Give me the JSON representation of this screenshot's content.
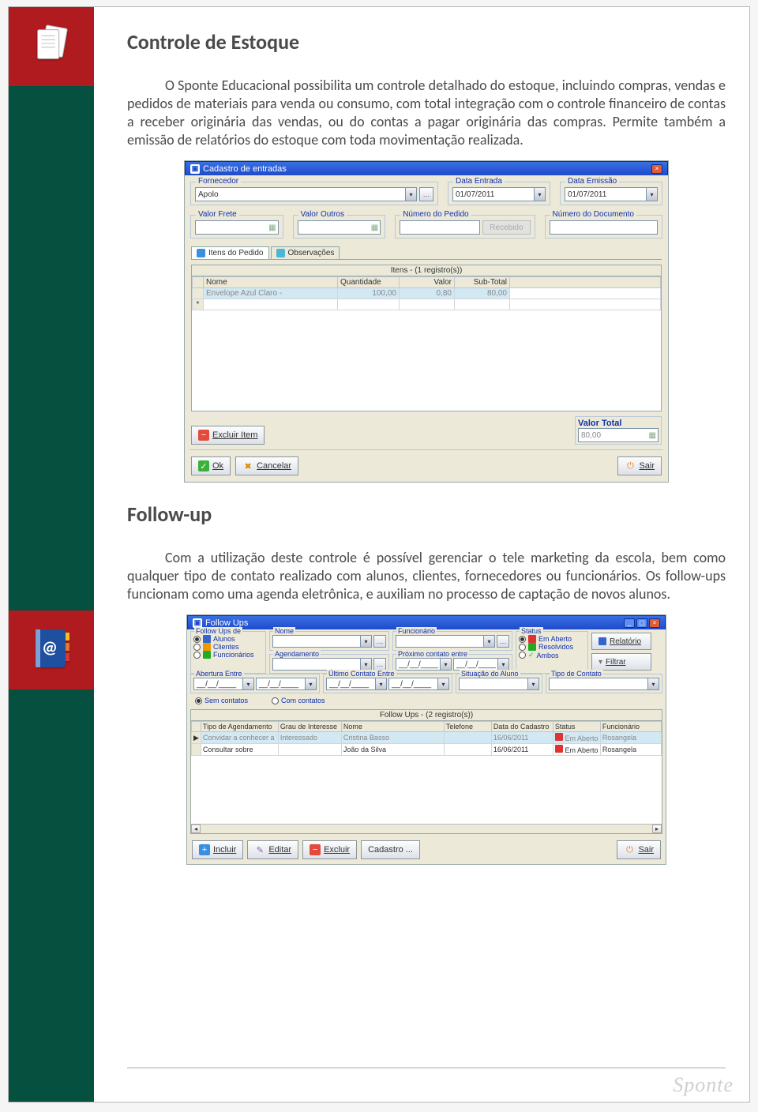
{
  "section1": {
    "heading": "Controle de Estoque",
    "paragraph": "O Sponte Educacional possibilita um controle detalhado do estoque, incluindo compras, vendas e pedidos de materiais para venda ou consumo, com total integração com o controle financeiro de contas a receber originária das vendas, ou do contas a pagar originária das compras. Permite também a emissão de relatórios do estoque com toda movimentação realizada."
  },
  "win1": {
    "title": "Cadastro de entradas",
    "fornecedor_label": "Fornecedor",
    "fornecedor_value": "Apolo",
    "data_entrada_label": "Data Entrada",
    "data_entrada_value": "01/07/2011",
    "data_emissao_label": "Data Emissão",
    "data_emissao_value": "01/07/2011",
    "valor_frete_label": "Valor Frete",
    "valor_outros_label": "Valor Outros",
    "numero_pedido_label": "Número do Pedido",
    "numero_doc_label": "Número do Documento",
    "disabled_btn": "Recebido",
    "tab_itens": "Itens do Pedido",
    "tab_obs": "Observações",
    "grid_caption": "Itens - (1 registro(s))",
    "cols": {
      "nome": "Nome",
      "qtd": "Quantidade",
      "valor": "Valor",
      "sub": "Sub-Total"
    },
    "row": {
      "nome": "Envelope Azul Claro -",
      "qtd": "100,00",
      "valor": "0,80",
      "sub": "80,00"
    },
    "excluir_item": "Excluir Item",
    "valor_total_label": "Valor Total",
    "valor_total_value": "80,00",
    "ok": "Ok",
    "cancelar": "Cancelar",
    "sair": "Sair"
  },
  "section2": {
    "heading": "Follow-up",
    "paragraph": "Com a utilização deste controle é possível gerenciar o tele marketing da escola, bem como qualquer tipo de contato realizado com alunos, clientes, fornecedores ou funcionários. Os follow-ups funcionam como uma agenda eletrônica, e auxiliam no processo de captação de novos alunos."
  },
  "win2": {
    "title": "Follow Ups",
    "followups_de": "Follow Ups de",
    "opt_alunos": "Alunos",
    "opt_clientes": "Clientes",
    "opt_func": "Funcionários",
    "nome_label": "Nome",
    "agendamento_label": "Agendamento",
    "date_mask": "__/__/____",
    "funcionario_label": "Funcionário",
    "proximo_label": "Próximo contato entre",
    "status_label": "Status",
    "status_aberto": "Em Aberto",
    "status_resolv": "Resolvidos",
    "status_ambos": "Ambos",
    "relatorio": "Relatório",
    "filtrar": "Filtrar",
    "abertura_entre": "Abertura Entre",
    "ultimo_contato": "Último Contato Entre",
    "situacao_aluno": "Situação do Aluno",
    "tipo_contato": "Tipo de Contato",
    "sem_contatos": "Sem contatos",
    "com_contatos": "Com contatos",
    "grid_caption": "Follow Ups - (2 registro(s))",
    "cols": {
      "tipo_ag": "Tipo de Agendamento",
      "grau": "Grau de Interesse",
      "nome": "Nome",
      "tel": "Telefone",
      "data": "Data do Cadastro",
      "status": "Status",
      "func": "Funcionário"
    },
    "rows": [
      {
        "tipo_ag": "Convidar a conhecer a",
        "grau": "Interessado",
        "nome": "Cristina Basso",
        "tel": "",
        "data": "16/06/2011",
        "status": "Em Aberto",
        "func": "Rosangela"
      },
      {
        "tipo_ag": "Consultar sobre",
        "grau": "",
        "nome": "João da Silva",
        "tel": "",
        "data": "16/06/2011",
        "status": "Em Aberto",
        "func": "Rosangela"
      }
    ],
    "incluir": "Incluir",
    "editar": "Editar",
    "excluir": "Excluir",
    "cadastro": "Cadastro ...",
    "sair": "Sair"
  },
  "footer_brand": "Sponte"
}
